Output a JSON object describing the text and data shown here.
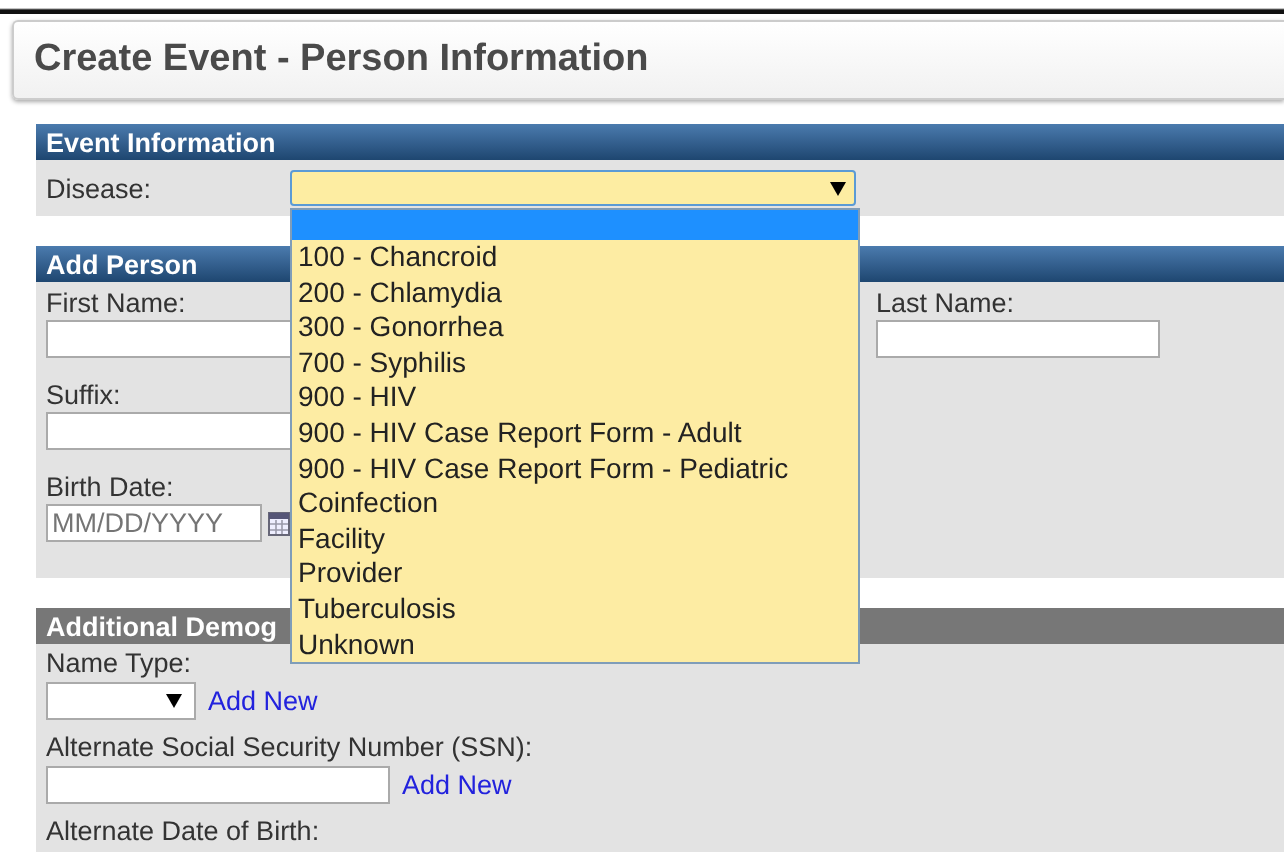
{
  "page_title": "Create Event - Person Information",
  "event_information": {
    "heading": "Event Information",
    "disease": {
      "label": "Disease:",
      "expanded": true,
      "blank_option": {
        "selected": true
      },
      "options": [
        {
          "label": "100 - Chancroid",
          "selected": false
        },
        {
          "label": "200 - Chlamydia",
          "selected": false
        },
        {
          "label": "300 - Gonorrhea",
          "selected": false
        },
        {
          "label": "700 - Syphilis",
          "selected": false
        },
        {
          "label": "900 - HIV",
          "selected": false
        },
        {
          "label": "900 - HIV Case Report Form - Adult",
          "selected": false
        },
        {
          "label": "900 - HIV Case Report Form - Pediatric",
          "selected": false
        },
        {
          "label": "Coinfection",
          "selected": false
        },
        {
          "label": "Facility",
          "selected": false
        },
        {
          "label": "Provider",
          "selected": false
        },
        {
          "label": "Tuberculosis",
          "selected": false
        },
        {
          "label": "Unknown",
          "selected": false
        }
      ]
    }
  },
  "add_person": {
    "heading": "Add Person",
    "first_name": {
      "label": "First Name:"
    },
    "last_name": {
      "label": "Last Name:"
    },
    "suffix": {
      "label": "Suffix:"
    },
    "birth_date": {
      "label": "Birth Date:",
      "placeholder": "MM/DD/YYYY"
    }
  },
  "additional_demographics": {
    "heading": "Additional Demog",
    "name_type": {
      "label": "Name Type:",
      "link": "Add New"
    },
    "alternate_ssn": {
      "label": "Alternate Social Security Number (SSN):",
      "link": "Add New"
    },
    "alternate_dob": {
      "label": "Alternate Date of Birth:"
    }
  }
}
